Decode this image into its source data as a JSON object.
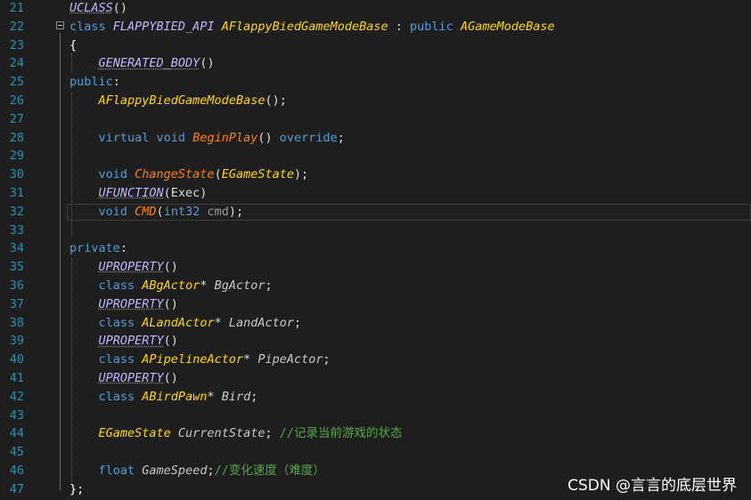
{
  "editor": {
    "lines": [
      {
        "n": "21",
        "tokens": [
          {
            "t": "UCLASS",
            "c": "mac"
          },
          {
            "t": "()",
            "c": "plain"
          }
        ]
      },
      {
        "n": "22",
        "tokens": [
          {
            "t": "class ",
            "c": "kw"
          },
          {
            "t": "FLAPPYBIED_API",
            "c": "mac2"
          },
          {
            "t": " ",
            "c": "plain"
          },
          {
            "t": "AFlappyBiedGameModeBase",
            "c": "typ"
          },
          {
            "t": " : ",
            "c": "plain"
          },
          {
            "t": "public ",
            "c": "kw"
          },
          {
            "t": "AGameModeBase",
            "c": "typ"
          }
        ]
      },
      {
        "n": "23",
        "tokens": [
          {
            "t": "{",
            "c": "brace"
          }
        ]
      },
      {
        "n": "24",
        "tokens": [
          {
            "t": "    ",
            "c": "plain"
          },
          {
            "t": "GENERATED_BODY",
            "c": "mac"
          },
          {
            "t": "()",
            "c": "plain"
          }
        ]
      },
      {
        "n": "25",
        "tokens": [
          {
            "t": "public",
            "c": "kw"
          },
          {
            "t": ":",
            "c": "plain"
          }
        ]
      },
      {
        "n": "26",
        "tokens": [
          {
            "t": "    ",
            "c": "plain"
          },
          {
            "t": "AFlappyBiedGameModeBase",
            "c": "typ"
          },
          {
            "t": "();",
            "c": "plain"
          }
        ]
      },
      {
        "n": "27",
        "tokens": []
      },
      {
        "n": "28",
        "tokens": [
          {
            "t": "    ",
            "c": "plain"
          },
          {
            "t": "virtual ",
            "c": "kw"
          },
          {
            "t": "void ",
            "c": "kw"
          },
          {
            "t": "BeginPlay",
            "c": "fn"
          },
          {
            "t": "() ",
            "c": "plain"
          },
          {
            "t": "override",
            "c": "kw"
          },
          {
            "t": ";",
            "c": "plain"
          }
        ]
      },
      {
        "n": "29",
        "tokens": []
      },
      {
        "n": "30",
        "tokens": [
          {
            "t": "    ",
            "c": "plain"
          },
          {
            "t": "void ",
            "c": "kw"
          },
          {
            "t": "ChangeState",
            "c": "fn"
          },
          {
            "t": "(",
            "c": "plain"
          },
          {
            "t": "EGameState",
            "c": "typ"
          },
          {
            "t": ");",
            "c": "plain"
          }
        ]
      },
      {
        "n": "31",
        "tokens": [
          {
            "t": "    ",
            "c": "plain"
          },
          {
            "t": "UFUNCTION",
            "c": "mac"
          },
          {
            "t": "(Exec)",
            "c": "plain"
          }
        ]
      },
      {
        "n": "32",
        "tokens": [
          {
            "t": "    ",
            "c": "plain"
          },
          {
            "t": "void ",
            "c": "kw"
          },
          {
            "t": "CMD",
            "c": "fn"
          },
          {
            "t": "(",
            "c": "plain"
          },
          {
            "t": "int32 ",
            "c": "kw"
          },
          {
            "t": "cmd",
            "c": "param"
          },
          {
            "t": ");",
            "c": "plain"
          }
        ]
      },
      {
        "n": "33",
        "tokens": []
      },
      {
        "n": "34",
        "tokens": [
          {
            "t": "private",
            "c": "kw"
          },
          {
            "t": ":",
            "c": "plain"
          }
        ]
      },
      {
        "n": "35",
        "tokens": [
          {
            "t": "    ",
            "c": "plain"
          },
          {
            "t": "UPROPERTY",
            "c": "mac"
          },
          {
            "t": "()",
            "c": "plain"
          }
        ]
      },
      {
        "n": "36",
        "tokens": [
          {
            "t": "    ",
            "c": "plain"
          },
          {
            "t": "class ",
            "c": "kw"
          },
          {
            "t": "ABgActor",
            "c": "typ"
          },
          {
            "t": "* ",
            "c": "plain"
          },
          {
            "t": "BgActor",
            "c": "var"
          },
          {
            "t": ";",
            "c": "plain"
          }
        ]
      },
      {
        "n": "37",
        "tokens": [
          {
            "t": "    ",
            "c": "plain"
          },
          {
            "t": "UPROPERTY",
            "c": "mac"
          },
          {
            "t": "()",
            "c": "plain"
          }
        ]
      },
      {
        "n": "38",
        "tokens": [
          {
            "t": "    ",
            "c": "plain"
          },
          {
            "t": "class ",
            "c": "kw"
          },
          {
            "t": "ALandActor",
            "c": "typ"
          },
          {
            "t": "* ",
            "c": "plain"
          },
          {
            "t": "LandActor",
            "c": "var"
          },
          {
            "t": ";",
            "c": "plain"
          }
        ]
      },
      {
        "n": "39",
        "tokens": [
          {
            "t": "    ",
            "c": "plain"
          },
          {
            "t": "UPROPERTY",
            "c": "mac"
          },
          {
            "t": "()",
            "c": "plain"
          }
        ]
      },
      {
        "n": "40",
        "tokens": [
          {
            "t": "    ",
            "c": "plain"
          },
          {
            "t": "class ",
            "c": "kw"
          },
          {
            "t": "APipelineActor",
            "c": "typ"
          },
          {
            "t": "* ",
            "c": "plain"
          },
          {
            "t": "PipeActor",
            "c": "var"
          },
          {
            "t": ";",
            "c": "plain"
          }
        ]
      },
      {
        "n": "41",
        "tokens": [
          {
            "t": "    ",
            "c": "plain"
          },
          {
            "t": "UPROPERTY",
            "c": "mac"
          },
          {
            "t": "()",
            "c": "plain"
          }
        ]
      },
      {
        "n": "42",
        "tokens": [
          {
            "t": "    ",
            "c": "plain"
          },
          {
            "t": "class ",
            "c": "kw"
          },
          {
            "t": "ABirdPawn",
            "c": "typ"
          },
          {
            "t": "* ",
            "c": "plain"
          },
          {
            "t": "Bird",
            "c": "var"
          },
          {
            "t": ";",
            "c": "plain"
          }
        ]
      },
      {
        "n": "43",
        "tokens": []
      },
      {
        "n": "44",
        "tokens": [
          {
            "t": "    ",
            "c": "plain"
          },
          {
            "t": "EGameState ",
            "c": "typ"
          },
          {
            "t": "CurrentState",
            "c": "var"
          },
          {
            "t": "; ",
            "c": "plain"
          },
          {
            "t": "//记录当前游戏的状态",
            "c": "cm"
          }
        ]
      },
      {
        "n": "45",
        "tokens": []
      },
      {
        "n": "46",
        "tokens": [
          {
            "t": "    ",
            "c": "plain"
          },
          {
            "t": "float ",
            "c": "kw"
          },
          {
            "t": "GameSpeed",
            "c": "var"
          },
          {
            "t": ";",
            "c": "plain"
          },
          {
            "t": "//变化速度（难度）",
            "c": "cm"
          }
        ]
      },
      {
        "n": "47",
        "tokens": [
          {
            "t": "};",
            "c": "brace"
          }
        ]
      }
    ]
  },
  "watermark": "CSDN @言言的底层世界",
  "colors": {
    "background": "#1e1e1e",
    "line_number": "#2b91af",
    "keyword": "#569cd6",
    "macro": "#beb7ff",
    "type": "#ffd700",
    "function": "#ff8000",
    "comment": "#57a64a"
  }
}
